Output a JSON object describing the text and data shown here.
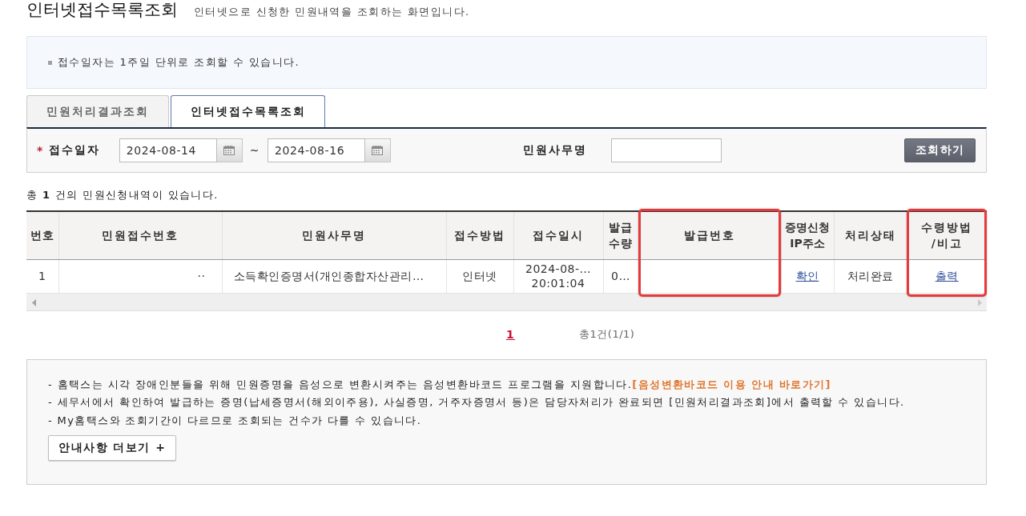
{
  "header": {
    "title": "인터넷접수목록조회",
    "description": "인터넷으로 신청한 민원내역을 조회하는 화면입니다."
  },
  "info_box": {
    "items": [
      "접수일자는 1주일 단위로 조회할 수 있습니다."
    ]
  },
  "tabs": [
    {
      "label": "민원처리결과조회",
      "selected": false
    },
    {
      "label": "인터넷접수목록조회",
      "selected": true
    }
  ],
  "search_form": {
    "date_field": {
      "required_mark": "*",
      "label": "접수일자",
      "from": "2024-08-14",
      "separator": "~",
      "to": "2024-08-16"
    },
    "name_field": {
      "label": "민원사무명"
    },
    "submit_button": "조회하기"
  },
  "result_summary": "총 **1** 건의 민원신청내역이 있습니다.",
  "table": {
    "columns": [
      {
        "label": "번호",
        "highlighted": false
      },
      {
        "label": "민원접수번호",
        "highlighted": false
      },
      {
        "label": "민원사무명",
        "highlighted": false
      },
      {
        "label": "접수방법",
        "highlighted": false
      },
      {
        "label": "접수일시",
        "highlighted": false
      },
      {
        "label": "발급\n수량",
        "highlighted": false
      },
      {
        "label": "발급번호",
        "highlighted": true
      },
      {
        "label": "증명신청\nIP주소",
        "highlighted": false
      },
      {
        "label": "처리상태",
        "highlighted": false
      },
      {
        "label": "수령방법\n/비고",
        "highlighted": true
      }
    ],
    "rows": [
      {
        "cells": [
          {
            "kind": "text",
            "text": "1"
          },
          {
            "kind": "text",
            "text": "··"
          },
          {
            "kind": "text",
            "text": "소득확인증명서(개인종합자산관리…"
          },
          {
            "kind": "text",
            "text": "인터넷"
          },
          {
            "kind": "text",
            "text": "2024-08-…\n20:01:04"
          },
          {
            "kind": "text",
            "text": "0…"
          },
          {
            "kind": "blank"
          },
          {
            "kind": "link",
            "text": "확인"
          },
          {
            "kind": "text",
            "text": "처리완료"
          },
          {
            "kind": "link",
            "text": "출력"
          }
        ]
      }
    ]
  },
  "pagination": {
    "pages": [
      {
        "label": "1",
        "selected": true
      }
    ],
    "summary": "총1건(1/1)"
  },
  "notice": {
    "items": [
      {
        "text": "- 홈택스는 시각 장애인분들을 위해 민원증명을 음성으로 변환시켜주는 음성변환바코드 프로그램을 지원합니다.",
        "link": "[음성변환바코드 이용 안내 바로가기]"
      },
      {
        "text": "- 세무서에서 확인하여 발급하는 증명(납세증명서(해외이주용), 사실증명, 거주자증명서 등)은 담당자처리가 완료되면 [민원처리결과조회]에서 출력할 수 있습니다."
      },
      {
        "text": "- My홈택스와 조회기간이 다르므로 조회되는 건수가 다를 수 있습니다."
      }
    ],
    "more_button": "안내사항 더보기 +"
  }
}
